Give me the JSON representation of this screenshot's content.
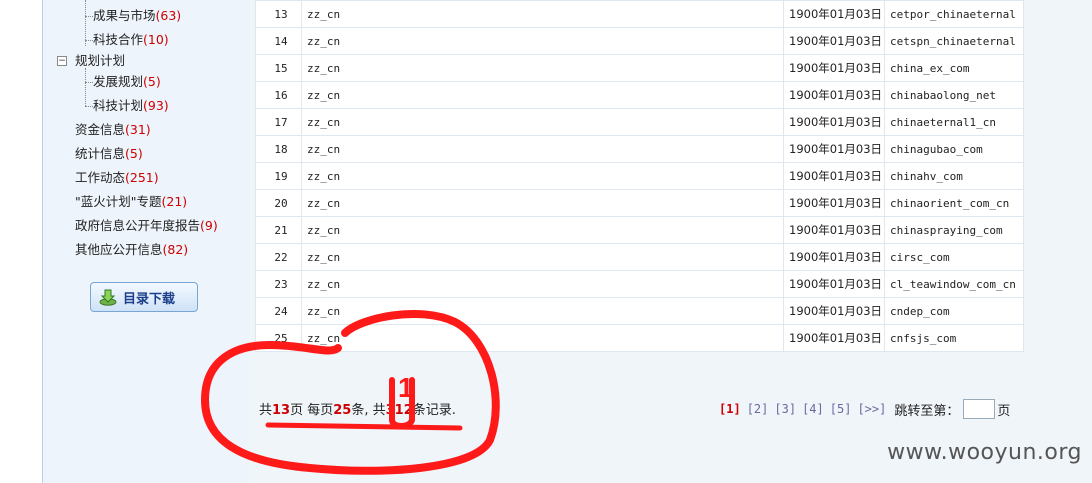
{
  "sidebar": {
    "items": [
      {
        "label": "成果与市场",
        "count": "(63)"
      },
      {
        "label": "科技合作",
        "count": "(10)"
      },
      {
        "label": "规划计划",
        "count": ""
      },
      {
        "label": "发展规划",
        "count": "(5)"
      },
      {
        "label": "科技计划",
        "count": "(93)"
      },
      {
        "label": "资金信息",
        "count": "(31)"
      },
      {
        "label": "统计信息",
        "count": "(5)"
      },
      {
        "label": "工作动态",
        "count": "(251)"
      },
      {
        "label": "\"蓝火计划\"专题",
        "count": "(21)"
      },
      {
        "label": "政府信息公开年度报告",
        "count": "(9)"
      },
      {
        "label": "其他应公开信息",
        "count": "(82)"
      }
    ],
    "expander_symbol": "−",
    "download_button": {
      "label": "目录下载",
      "icon": "download-arrow-icon"
    }
  },
  "table": {
    "rows": [
      {
        "num": "13",
        "user": "zz_cn",
        "date": "1900年01月03日",
        "name": "cetpor_chinaeternal"
      },
      {
        "num": "14",
        "user": "zz_cn",
        "date": "1900年01月03日",
        "name": "cetspn_chinaeternal"
      },
      {
        "num": "15",
        "user": "zz_cn",
        "date": "1900年01月03日",
        "name": "china_ex_com"
      },
      {
        "num": "16",
        "user": "zz_cn",
        "date": "1900年01月03日",
        "name": "chinabaolong_net"
      },
      {
        "num": "17",
        "user": "zz_cn",
        "date": "1900年01月03日",
        "name": "chinaeternal1_cn"
      },
      {
        "num": "18",
        "user": "zz_cn",
        "date": "1900年01月03日",
        "name": "chinagubao_com"
      },
      {
        "num": "19",
        "user": "zz_cn",
        "date": "1900年01月03日",
        "name": "chinahv_com"
      },
      {
        "num": "20",
        "user": "zz_cn",
        "date": "1900年01月03日",
        "name": "chinaorient_com_cn"
      },
      {
        "num": "21",
        "user": "zz_cn",
        "date": "1900年01月03日",
        "name": "chinaspraying_com"
      },
      {
        "num": "22",
        "user": "zz_cn",
        "date": "1900年01月03日",
        "name": "cirsc_com"
      },
      {
        "num": "23",
        "user": "zz_cn",
        "date": "1900年01月03日",
        "name": "cl_teawindow_com_cn"
      },
      {
        "num": "24",
        "user": "zz_cn",
        "date": "1900年01月03日",
        "name": "cndep_com"
      },
      {
        "num": "25",
        "user": "zz_cn",
        "date": "1900年01月03日",
        "name": "cnfsjs_com"
      }
    ]
  },
  "summary": {
    "prefix": "共",
    "pages": "13",
    "pages_suffix": "页 每页",
    "per_page": "25",
    "per_page_suffix": "条, 共",
    "total": "312",
    "total_suffix": "条记录."
  },
  "pager": {
    "pages": [
      "[1]",
      "[2]",
      "[3]",
      "[4]",
      "[5]",
      "[>>]"
    ],
    "active_index": 0,
    "jump_label": "跳转至第：",
    "jump_value": "",
    "jump_suffix": "页"
  },
  "annotation": {
    "mark": "1",
    "color": "#ff0000"
  },
  "watermark": "www.wooyun.org"
}
